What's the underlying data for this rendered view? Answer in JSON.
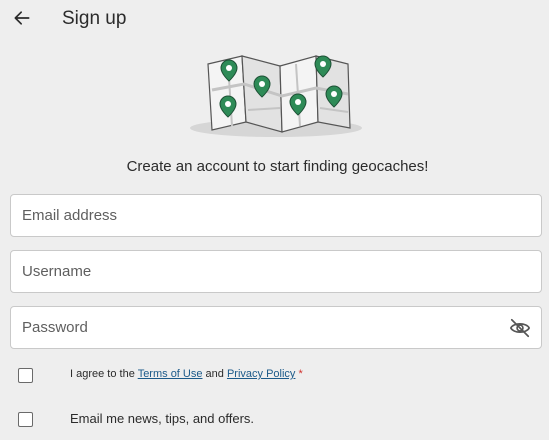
{
  "header": {
    "title": "Sign up",
    "back_icon": "arrow-left-icon"
  },
  "illustration": {
    "icon": "map-with-pins-icon"
  },
  "subtitle": "Create an account to start finding geocaches!",
  "form": {
    "email_placeholder": "Email address",
    "email_value": "",
    "username_placeholder": "Username",
    "username_value": "",
    "password_placeholder": "Password",
    "password_value": "",
    "password_toggle_icon": "eye-off-icon"
  },
  "terms": {
    "prefix": "I agree to the ",
    "terms_link": "Terms of Use",
    "middle": " and ",
    "privacy_link": "Privacy Policy",
    "required_mark": "*",
    "checked": false
  },
  "newsletter": {
    "label": "Email me news, tips, and offers.",
    "checked": false
  },
  "colors": {
    "background": "#eeeeee",
    "pin_green": "#2e8b57",
    "link_blue": "#1c5a8a",
    "required_red": "#d0322d"
  }
}
